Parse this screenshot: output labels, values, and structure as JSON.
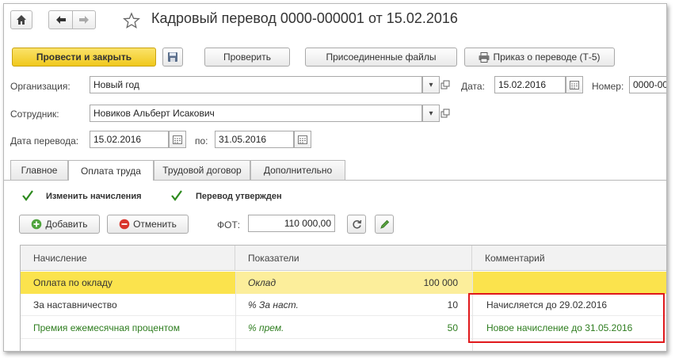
{
  "window": {
    "title": "Кадровый перевод 0000-000001 от 15.02.2016"
  },
  "nav": {
    "home_icon": "home-icon",
    "back_icon": "arrow-left-icon",
    "forward_icon": "arrow-right-icon",
    "favorite_icon": "star-icon"
  },
  "toolbar": {
    "post_close": "Провести и закрыть",
    "save_icon": "floppy-disk-icon",
    "check": "Проверить",
    "attached_files": "Присоединенные файлы",
    "print_order": "Приказ о переводе (Т-5)"
  },
  "form": {
    "org_label": "Организация:",
    "org_value": "Новый год",
    "date_label": "Дата:",
    "date_value": "15.02.2016",
    "number_label": "Номер:",
    "number_value": "0000-00",
    "employee_label": "Сотрудник:",
    "employee_value": "Новиков Альберт Исакович",
    "transfer_date_label": "Дата перевода:",
    "transfer_date_value": "15.02.2016",
    "to_label": "по:",
    "to_value": "31.05.2016"
  },
  "tabs": [
    {
      "label": "Главное",
      "active": false
    },
    {
      "label": "Оплата труда",
      "active": true
    },
    {
      "label": "Трудовой договор",
      "active": false
    },
    {
      "label": "Дополнительно",
      "active": false
    }
  ],
  "pay": {
    "change_accruals": "Изменить начисления",
    "transfer_approved": "Перевод утвержден",
    "add": "Добавить",
    "cancel": "Отменить",
    "fot_label": "ФОТ:",
    "fot_value": "110 000,00"
  },
  "table": {
    "headers": [
      "Начисление",
      "Показатели",
      "Комментарий"
    ],
    "rows": [
      {
        "accrual": "Оплата по окладу",
        "indicator": "Оклад",
        "value": "100 000",
        "comment": ""
      },
      {
        "accrual": "За наставничество",
        "indicator": "%  За наст.",
        "value": "10",
        "comment": "Начисляется до 29.02.2016"
      },
      {
        "accrual": "Премия ежемесячная процентом",
        "indicator": "% прем.",
        "value": "50",
        "comment": "Новое начисление до 31.05.2016"
      }
    ]
  },
  "colors": {
    "accent_yellow": "#f5d31b",
    "highlight_row": "#fbe34d",
    "new_row_text": "#2e7d1f",
    "annotation_red": "#e0191c"
  }
}
